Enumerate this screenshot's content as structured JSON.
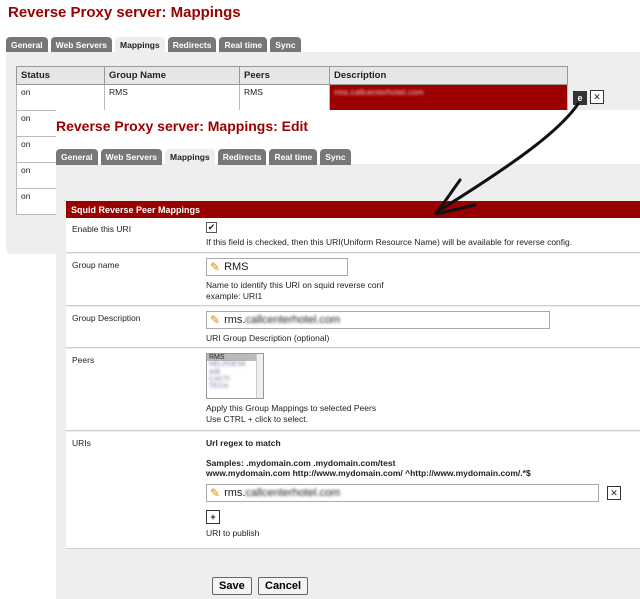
{
  "bg": {
    "title": "Reverse Proxy server: Mappings",
    "tabs": [
      "General",
      "Web Servers",
      "Mappings",
      "Redirects",
      "Real time",
      "Sync"
    ],
    "columns": [
      "Status",
      "Group Name",
      "Peers",
      "Description"
    ],
    "rows": [
      {
        "status": "on",
        "group": "RMS",
        "peers": "RMS",
        "desc": "rms.callcenterhotel.com"
      },
      {
        "status": "on"
      },
      {
        "status": "on"
      },
      {
        "status": "on"
      },
      {
        "status": "on"
      }
    ]
  },
  "edit": {
    "title": "Reverse Proxy server: Mappings: Edit",
    "tabs": [
      "General",
      "Web Servers",
      "Mappings",
      "Redirects",
      "Real time",
      "Sync"
    ],
    "section": "Squid Reverse Peer Mappings",
    "enable": {
      "label": "Enable this URI",
      "checked": true,
      "check_mark": "✔",
      "help": "If this field is checked, then this URI(Uniform Resource Name) will be available for reverse config."
    },
    "group_name": {
      "label": "Group name",
      "value": "RMS",
      "help1": "Name to identify this URI on squid reverse conf",
      "help2": "example: URI1"
    },
    "group_desc": {
      "label": "Group Description",
      "value_prefix": "rms.",
      "value_blurred": "callcenterhotel.com",
      "help": "URI Group Description (optional)"
    },
    "peers": {
      "label": "Peers",
      "options": [
        "RMS",
        "HELPDESK",
        "AIB",
        "CACTI",
        "TECH"
      ],
      "selected": "RMS",
      "help1": "Apply this Group Mappings to selected Peers",
      "help2": "Use CTRL + click to select."
    },
    "uris": {
      "label": "URIs",
      "header": "Url regex to match",
      "samples1": "Samples: .mydomain.com .mydomain.com/test",
      "samples2": "www.mydomain.com http://www.mydomain.com/ ^http://www.mydomain.com/.*$",
      "value_prefix": "rms.",
      "value_blurred": "callcenterhotel.com",
      "publish_label": "URI to publish"
    },
    "save_label": "Save",
    "cancel_label": "Cancel"
  },
  "colors": {
    "accent": "#990000",
    "panel": "#eeeeee",
    "tab": "#777777"
  }
}
